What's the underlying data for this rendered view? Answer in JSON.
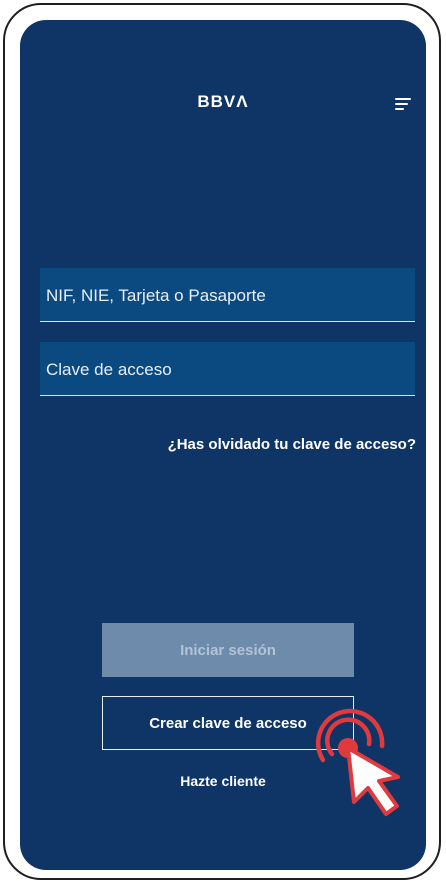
{
  "header": {
    "logo_text": "BBVΛ",
    "menu_icon": "hamburger-menu-icon"
  },
  "login_form": {
    "user_placeholder": "NIF, NIE, Tarjeta o Pasaporte",
    "password_placeholder": "Clave de acceso",
    "forgot_link": "¿Has olvidado tu clave de acceso?"
  },
  "actions": {
    "login_button": "Iniciar sesión",
    "create_button": "Crear clave de acceso",
    "signup_link": "Hazte cliente"
  },
  "overlay": {
    "tap_icon": "tap-cursor-icon"
  },
  "colors": {
    "background": "#0f3566",
    "input_fill": "#0b4a80",
    "disabled_button": "#6e8bab",
    "tap_accent": "#e03a3e"
  }
}
